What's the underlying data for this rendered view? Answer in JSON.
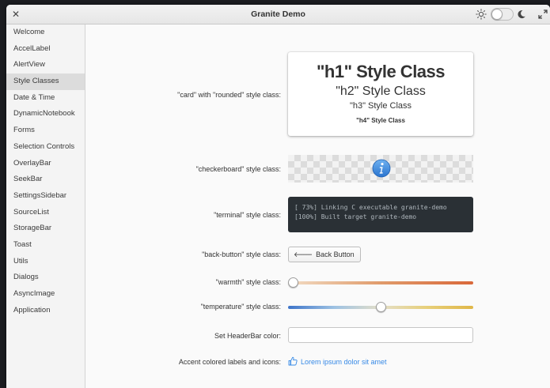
{
  "window": {
    "title": "Granite Demo"
  },
  "headerbar": {
    "close_icon": "close-icon",
    "light_icon": "sun-icon",
    "dark_icon": "moon-icon",
    "maximize_icon": "maximize-icon",
    "dark_mode": false
  },
  "sidebar": {
    "items": [
      {
        "label": "Welcome"
      },
      {
        "label": "AccelLabel"
      },
      {
        "label": "AlertView"
      },
      {
        "label": "Style Classes",
        "active": true
      },
      {
        "label": "Date & Time"
      },
      {
        "label": "DynamicNotebook"
      },
      {
        "label": "Forms"
      },
      {
        "label": "Selection Controls"
      },
      {
        "label": "OverlayBar"
      },
      {
        "label": "SeekBar"
      },
      {
        "label": "SettingsSidebar"
      },
      {
        "label": "SourceList"
      },
      {
        "label": "StorageBar"
      },
      {
        "label": "Toast"
      },
      {
        "label": "Utils"
      },
      {
        "label": "Dialogs"
      },
      {
        "label": "AsyncImage"
      },
      {
        "label": "Application"
      }
    ]
  },
  "rows": {
    "card_label": "\"card\" with \"rounded\" style class:",
    "checkerboard_label": "\"checkerboard\" style class:",
    "terminal_label": "\"terminal\" style class:",
    "back_button_label": "\"back-button\" style class:",
    "warmth_label": "\"warmth\" style class:",
    "temperature_label": "\"temperature\" style class:",
    "headerbar_color_label": "Set HeaderBar color:",
    "accent_label": "Accent colored labels and icons:"
  },
  "card": {
    "h1": "\"h1\" Style Class",
    "h2": "\"h2\" Style Class",
    "h3": "\"h3\" Style Class",
    "h4": "\"h4\" Style Class"
  },
  "checkerboard": {
    "icon": "info-icon"
  },
  "terminal": {
    "line1": "[ 73%] Linking C executable granite-demo",
    "line2": "[100%] Built target granite-demo"
  },
  "back_button": {
    "label": "Back Button",
    "icon": "left-arrow-icon"
  },
  "warmth": {
    "value_fraction": 0.0
  },
  "temperature": {
    "value_fraction": 0.5
  },
  "headerbar_color": {
    "value": ""
  },
  "accent": {
    "text": "Lorem ipsum dolor sit amet",
    "icon": "thumbs-up-icon",
    "color": "#3689e6"
  },
  "colors": {
    "accent": "#3689e6",
    "terminal_bg": "#2a3035",
    "active_sidebar": "#dcdcdc"
  }
}
